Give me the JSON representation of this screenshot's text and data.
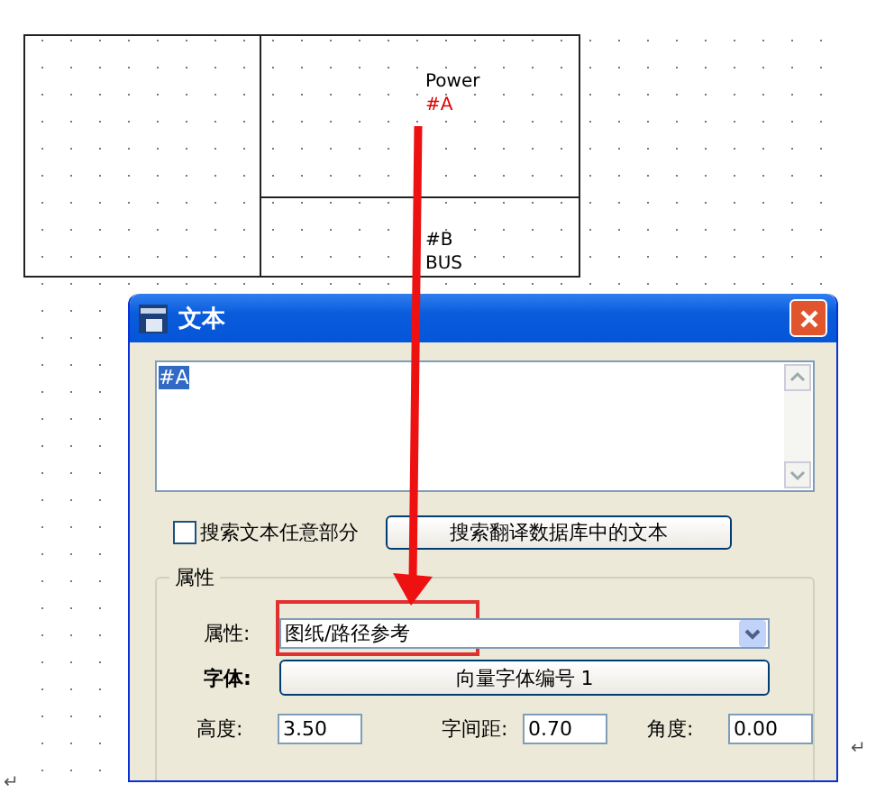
{
  "drawing": {
    "top_cell": [
      {
        "text": "Power",
        "color": "#000000"
      },
      {
        "text": "#A",
        "color": "#e00000"
      }
    ],
    "bottom_cell": [
      {
        "text": "#B",
        "color": "#000000"
      },
      {
        "text": "BUS",
        "color": "#000000"
      }
    ]
  },
  "dialog": {
    "title": "文本",
    "text_value": "#A",
    "search_any_part": {
      "label": "搜索文本任意部分",
      "checked": false
    },
    "search_button": "搜索翻译数据库中的文本",
    "group": {
      "title": "属性",
      "attribute": {
        "label": "属性:",
        "value": "图纸/路径参考"
      },
      "font": {
        "label": "字体:",
        "button": "向量字体编号 1"
      },
      "fields": [
        {
          "label": "高度:",
          "value": "3.50"
        },
        {
          "label": "字间距:",
          "value": "0.70"
        },
        {
          "label": "角度:",
          "value": "0.00"
        }
      ]
    }
  },
  "paragraph_marks": [
    "↵",
    "↵"
  ]
}
